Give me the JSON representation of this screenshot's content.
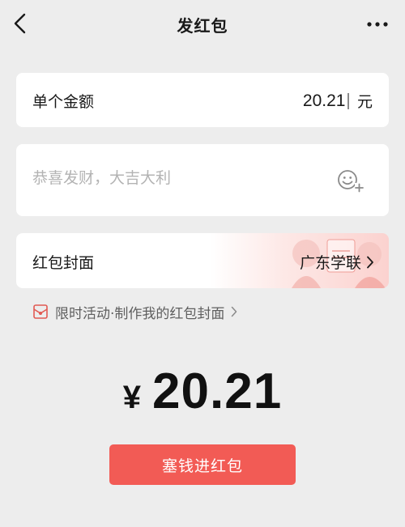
{
  "header": {
    "title": "发红包",
    "back_icon": "chevron-left-icon",
    "more_icon": "more-dots-icon"
  },
  "amount_field": {
    "label": "单个金额",
    "value": "20.21",
    "unit": "元"
  },
  "greeting_field": {
    "placeholder": "恭喜发财，大吉大利",
    "value": "",
    "emoji_icon": "emoji-add-icon"
  },
  "cover": {
    "label": "红包封面",
    "selected": "广东学联"
  },
  "promo": {
    "text": "限时活动·制作我的红包封面",
    "icon": "red-packet-icon"
  },
  "total": {
    "currency": "¥",
    "value": "20.21"
  },
  "submit_button": {
    "label": "塞钱进红包"
  },
  "colors": {
    "background": "#ededed",
    "card": "#ffffff",
    "accent_red": "#f25b55",
    "placeholder": "#b3b3b3",
    "secondary_text": "#5f5f5f"
  }
}
